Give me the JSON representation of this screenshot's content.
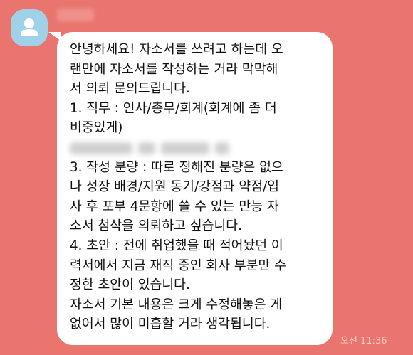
{
  "colors": {
    "background": "#e9756e",
    "bubble": "#ffffff",
    "avatar": "#9fd2e6",
    "timestamp": "#f7c9c5"
  },
  "sender": {
    "avatar_icon": "person-icon"
  },
  "message": {
    "lines": [
      "안녕하세요! 자소서를 쓰려고 하는데 오",
      "랜만에 자소서를 작성하는 거라 막막해",
      "서 의뢰 문의드립니다.",
      "1. 직무 : 인사/총무/회계(회계에 좀 더",
      "비중있게)",
      "3. 작성 분량 : 따로 정해진 분량은 없으",
      "나 성장 배경/지원 동기/강점과 약점/입",
      "사 후 포부 4문항에 쓸 수 있는 만능 자",
      "소서 첨삭을 의뢰하고 싶습니다.",
      "4. 초안 : 전에 취업했을 때 적어놨던 이",
      "력서에서 지금 재직 중인 회사 부분만 수",
      "정한 초안이 있습니다.",
      "자소서 기본 내용은 크게 수정해놓은 게",
      "없어서 많이 미흡할 거라 생각됩니다."
    ],
    "timestamp": "오전 11:36"
  }
}
